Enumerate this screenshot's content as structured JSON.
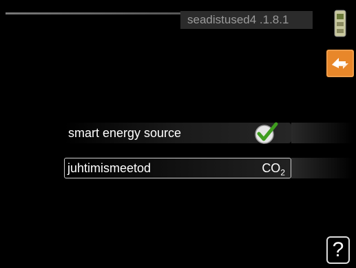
{
  "header": {
    "menu_code": "seadistused4 .1.8.1"
  },
  "icons": {
    "scroll": "scroll-position-icon",
    "category": "settings-arrows-icon",
    "check": "checkmark-icon",
    "help": "help-icon"
  },
  "settings": [
    {
      "label": "smart energy source",
      "state": "checked"
    },
    {
      "label": "juhtimismeetod",
      "value_main": "CO",
      "value_sub": "2"
    }
  ],
  "help": {
    "symbol": "?"
  },
  "colors": {
    "accent": "#e8872a",
    "check_green": "#4caf2a",
    "background": "#000000"
  }
}
